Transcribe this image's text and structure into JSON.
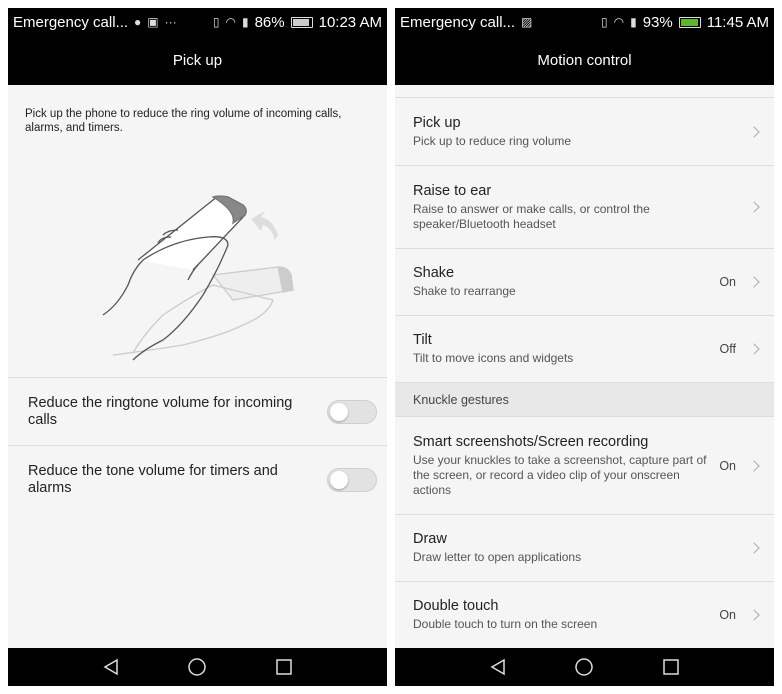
{
  "left": {
    "status": {
      "carrier": "Emergency call...",
      "battery": "86%",
      "time": "10:23 AM"
    },
    "title": "Pick up",
    "description": "Pick up the phone to reduce the ring volume of incoming calls, alarms, and timers.",
    "toggles": [
      {
        "label": "Reduce the ringtone volume for incoming calls",
        "on": false
      },
      {
        "label": "Reduce the tone volume for timers and alarms",
        "on": false
      }
    ]
  },
  "right": {
    "status": {
      "carrier": "Emergency call...",
      "battery": "93%",
      "time": "11:45 AM"
    },
    "title": "Motion control",
    "items": [
      {
        "title": "Pick up",
        "subtitle": "Pick up to reduce ring volume",
        "value": ""
      },
      {
        "title": "Raise to ear",
        "subtitle": "Raise to answer or make calls, or control the speaker/Bluetooth headset",
        "value": ""
      },
      {
        "title": "Shake",
        "subtitle": "Shake to rearrange",
        "value": "On"
      },
      {
        "title": "Tilt",
        "subtitle": "Tilt to move icons and widgets",
        "value": "Off"
      }
    ],
    "section": "Knuckle gestures",
    "items2": [
      {
        "title": "Smart screenshots/Screen recording",
        "subtitle": "Use your knuckles to take a screenshot, capture part of the screen, or record a video clip of your onscreen actions",
        "value": "On"
      },
      {
        "title": "Draw",
        "subtitle": "Draw letter to open applications",
        "value": ""
      },
      {
        "title": "Double touch",
        "subtitle": "Double touch to turn on the screen",
        "value": "On"
      }
    ]
  },
  "colors": {
    "bar": "#000000",
    "background": "#f5f5f5",
    "charging": "#5cb531"
  }
}
